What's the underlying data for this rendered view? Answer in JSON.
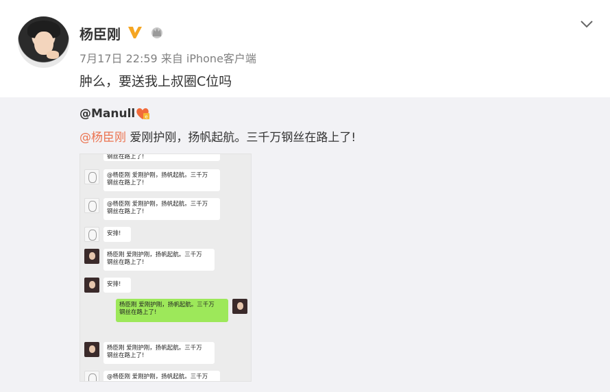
{
  "post": {
    "username": "杨臣刚",
    "verified_icon": "verified-v-icon",
    "crown_icon": "crown-icon",
    "meta": "7月17日 22:59 来自 iPhone客户端",
    "text": "肿么，要送我上叔圈C位吗"
  },
  "repost": {
    "author": "@Manull",
    "member_icon": "member-badge-icon",
    "mention": "@杨臣刚",
    "text": " 爱刚护刚，扬帆起航。三千万钢丝在路上了!"
  },
  "chat": {
    "top_fragment": "钢丝在路上了!",
    "m1_line1": "@杨臣刚 爱刚护刚，扬帆起航。三千万",
    "m1_line2": "钢丝在路上了!",
    "m2_line1": "@杨臣刚 爱刚护刚，扬帆起航。三千万",
    "m2_line2": "钢丝在路上了!",
    "m3": "安排!",
    "m4_line1": "杨臣刚 爱刚护刚，扬帆起航。三千万",
    "m4_line2": "钢丝在路上了!",
    "m5": "安排!",
    "m6_line1": "杨臣刚 爱刚护刚，扬帆起航。三千万",
    "m6_line2": "钢丝在路上了!",
    "m7_line1": "杨臣刚 爱刚护刚，扬帆起航。三千万",
    "m7_line2": "钢丝在路上了!",
    "m8_line1": "@杨臣刚 爱刚护刚，扬帆起航。三千万"
  },
  "colors": {
    "mention": "#eb7350",
    "repost_bg": "#f2f2f5",
    "verified": "#f5a623",
    "bubble_green": "#9de85a"
  }
}
